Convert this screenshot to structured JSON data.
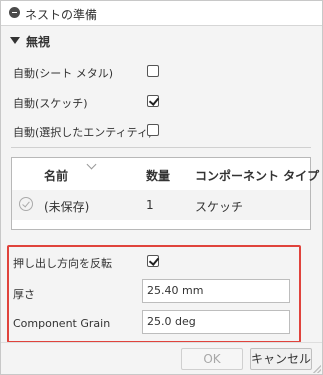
{
  "dialog": {
    "title": "ネストの準備"
  },
  "section": {
    "title": "無視",
    "options": [
      {
        "label": "自動(シート メタル)",
        "checked": false
      },
      {
        "label": "自動(スケッチ)",
        "checked": true
      },
      {
        "label": "自動(選択したエンティティ)",
        "checked": false
      }
    ]
  },
  "table": {
    "columns": [
      "名前",
      "数量",
      "コンポーネント タイプ"
    ],
    "rows": [
      {
        "name": "(未保存)",
        "quantity": "1",
        "type": "スケッチ"
      }
    ]
  },
  "highlighted": {
    "flip_label": "押し出し方向を反転",
    "flip_checked": true,
    "thickness_label": "厚さ",
    "thickness_value": "25.40 mm",
    "grain_label": "Component Grain",
    "grain_value": "25.0 deg",
    "highlight_color": "#e0433c"
  },
  "buttons": {
    "ok_label": "OK",
    "cancel_label": "キャンセル"
  }
}
